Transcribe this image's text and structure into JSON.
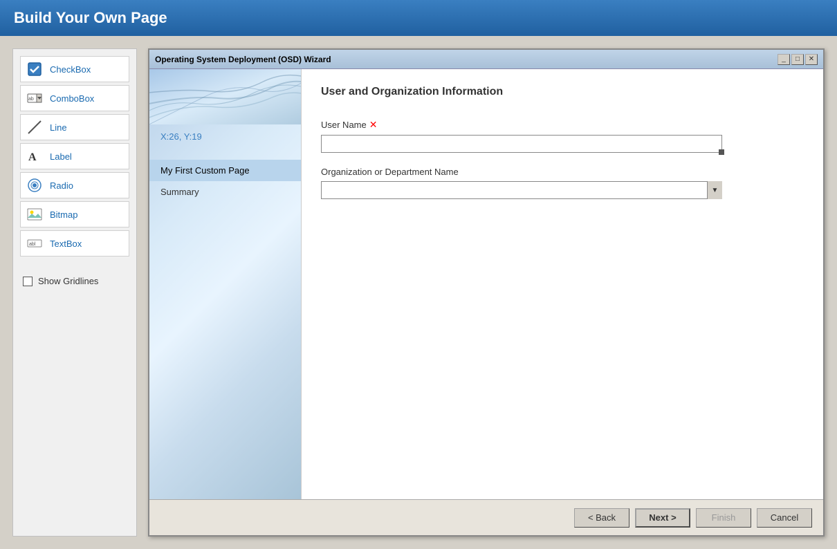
{
  "app": {
    "title": "Build Your Own Page"
  },
  "toolbox": {
    "items": [
      {
        "id": "checkbox",
        "label": "CheckBox",
        "icon": "checkbox"
      },
      {
        "id": "combobox",
        "label": "ComboBox",
        "icon": "combobox"
      },
      {
        "id": "line",
        "label": "Line",
        "icon": "line"
      },
      {
        "id": "label",
        "label": "Label",
        "icon": "label"
      },
      {
        "id": "radio",
        "label": "Radio",
        "icon": "radio"
      },
      {
        "id": "bitmap",
        "label": "Bitmap",
        "icon": "bitmap"
      },
      {
        "id": "textbox",
        "label": "TextBox",
        "icon": "textbox"
      }
    ],
    "show_gridlines_label": "Show Gridlines"
  },
  "wizard": {
    "title": "Operating System Deployment (OSD) Wizard",
    "window_buttons": [
      "minimize",
      "maximize",
      "close"
    ],
    "coords": "X:26, Y:19",
    "nav_items": [
      {
        "id": "custom-page",
        "label": "My First Custom Page",
        "active": true
      },
      {
        "id": "summary",
        "label": "Summary",
        "active": false
      }
    ],
    "content": {
      "section_title": "User and Organization Information",
      "fields": [
        {
          "id": "user-name",
          "label": "User Name",
          "required": true,
          "type": "text",
          "value": ""
        },
        {
          "id": "org-name",
          "label": "Organization or Department Name",
          "required": false,
          "type": "combo",
          "value": ""
        }
      ]
    },
    "footer": {
      "back_label": "< Back",
      "next_label": "Next >",
      "finish_label": "Finish",
      "cancel_label": "Cancel"
    }
  }
}
